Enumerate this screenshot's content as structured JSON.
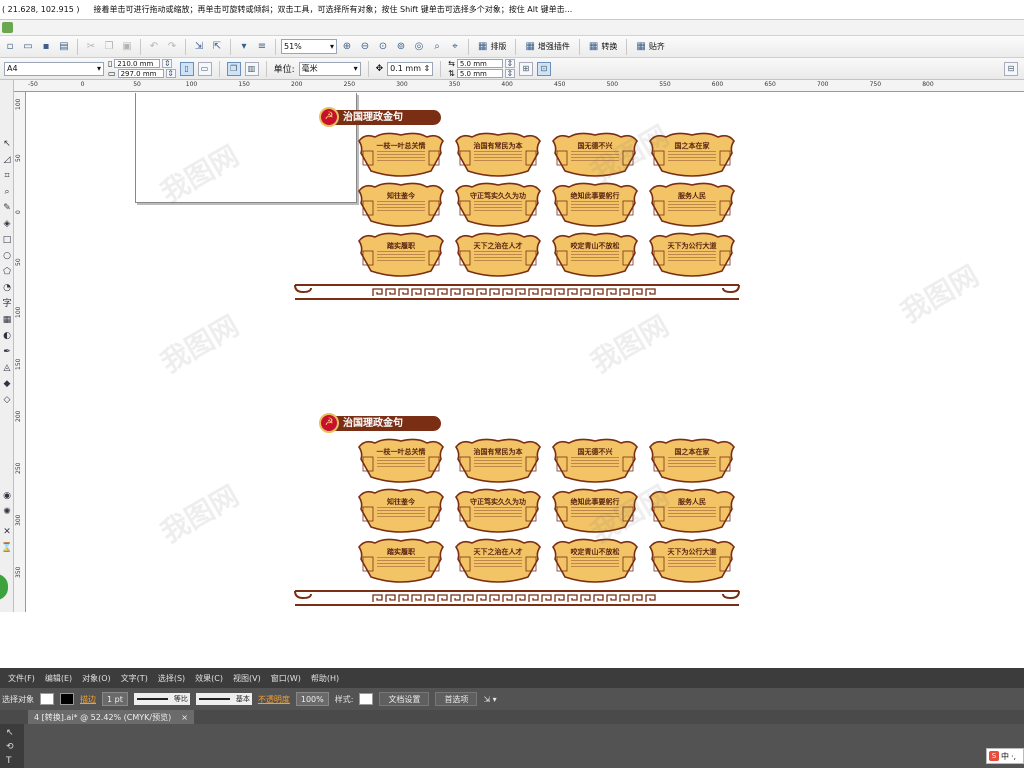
{
  "status": {
    "coords": "( 21.628, 102.915 )",
    "hint": "接着单击可进行拖动或缩放；再单击可旋转或倾斜；双击工具，可选择所有对象；按住 Shift 键单击可选择多个对象；按住 Alt 键单击..."
  },
  "toolbar": {
    "zoom": "51%",
    "arrange_label": "排版",
    "plugin_label": "增强插件",
    "convert_label": "转换",
    "paste_label": "贴齐"
  },
  "property_bar": {
    "paper": "A4",
    "width": "210.0 mm",
    "height": "297.0 mm",
    "units_label": "单位:",
    "units_value": "毫米",
    "nudge": "0.1 mm",
    "dup_x": "5.0 mm",
    "dup_y": "5.0 mm"
  },
  "ruler": {
    "h_ticks": [
      "-50",
      "0",
      "50",
      "100",
      "150",
      "200",
      "250",
      "300",
      "350",
      "400",
      "450",
      "500",
      "550",
      "600",
      "650",
      "700",
      "750",
      "800"
    ],
    "v_ticks": [
      "100",
      "50",
      "0",
      "50",
      "100",
      "150",
      "200",
      "250",
      "300",
      "350"
    ]
  },
  "design": {
    "banner_title": "治国理政金句",
    "cards": [
      "一枝一叶总关情",
      "治国有常民为本",
      "国无德不兴",
      "国之本在家",
      "知往鉴今",
      "守正笃实久久为功",
      "绝知此事要躬行",
      "服务人民",
      "踏实履职",
      "天下之治在人才",
      "咬定青山不放松",
      "天下为公行大道"
    ]
  },
  "watermark": "我图网",
  "second_app": {
    "menu": [
      "文件(F)",
      "编辑(E)",
      "对象(O)",
      "文字(T)",
      "选择(S)",
      "效果(C)",
      "视图(V)",
      "窗口(W)",
      "帮助(H)"
    ],
    "control_label": "选择对象",
    "stroke_label": "描边",
    "stroke_weight": "1 pt",
    "profile_uniform": "等比",
    "brush_basic": "基本",
    "opacity_label": "不透明度",
    "opacity_value": "100%",
    "style_label": "样式:",
    "doc_setup": "文档设置",
    "preferences": "首选项",
    "tab_title": "4 [转换].ai* @ 52.42% (CMYK/预览)",
    "ime": "中"
  },
  "colors": {
    "card_fill": "#f2c466",
    "card_border": "#7a2e14",
    "banner": "#7a2e14",
    "party_red": "#c8102e"
  }
}
